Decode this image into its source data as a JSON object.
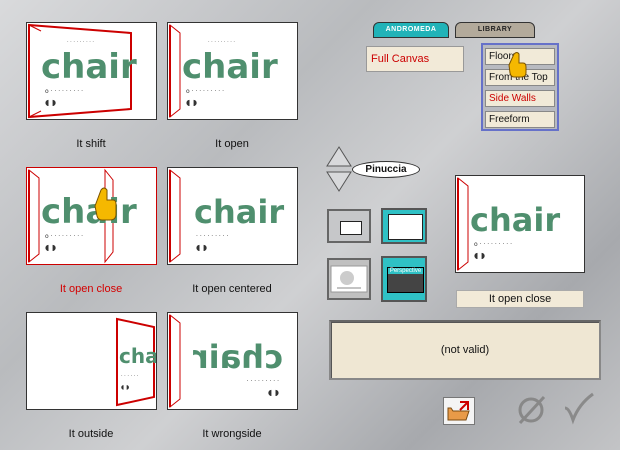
{
  "tabs": [
    {
      "label": "ANDROMEDA",
      "active": true
    },
    {
      "label": "LIBRARY",
      "active": false
    }
  ],
  "mode": {
    "label": "Full Canvas"
  },
  "menu": {
    "items": [
      {
        "label": "Floors"
      },
      {
        "label": "From the Top"
      },
      {
        "label": "Side Walls"
      },
      {
        "label": "Freeform"
      }
    ],
    "active_index": 2
  },
  "navigator": {
    "label": "Pinuccia"
  },
  "thumbnails": [
    {
      "caption": "It shift",
      "selected": false,
      "word": "chair"
    },
    {
      "caption": "It open",
      "selected": false,
      "word": "chair"
    },
    {
      "caption": "It open close",
      "selected": true,
      "word": "chair"
    },
    {
      "caption": "It open centered",
      "selected": false,
      "word": "chair"
    },
    {
      "caption": "It outside",
      "selected": false,
      "word": "chair"
    },
    {
      "caption": "It wrongside",
      "selected": false,
      "word": "chair"
    }
  ],
  "view_buttons": [
    {
      "name": "small-frame"
    },
    {
      "name": "large-frame"
    },
    {
      "name": "flat"
    },
    {
      "label": "Perspective"
    }
  ],
  "preview": {
    "label": "It open close",
    "word": "chair"
  },
  "status": {
    "text": "(not valid)"
  },
  "colors": {
    "accent_teal": "#21b3b8",
    "warning_red": "#d40000",
    "panel_beige": "#f2ead8",
    "menu_border": "#6671c9"
  },
  "icons": [
    "hand-pointer-icon",
    "arrow-up-icon",
    "arrow-down-icon",
    "open-folder-icon",
    "cancel-icon",
    "checkmark-icon"
  ]
}
